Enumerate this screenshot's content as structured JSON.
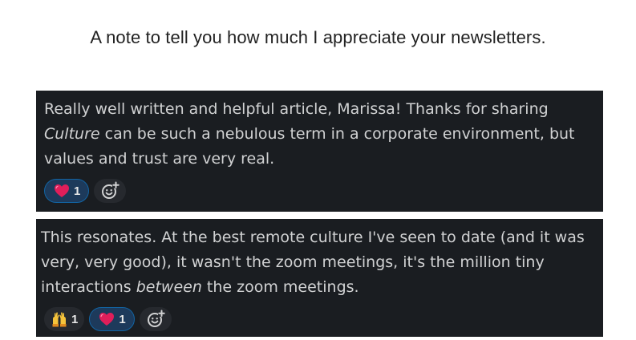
{
  "headline": "A note to tell you how much I appreciate your newsletters.",
  "messages": [
    {
      "line1": "Really well written and helpful article, Marissa! Thanks for sharing",
      "line2_italic": "Culture",
      "line2_rest": " can be such a nebulous term in a corporate environment, but",
      "line3": "values and trust are very real.",
      "reactions": [
        {
          "emoji": "heart-icon",
          "count": "1",
          "active": true
        }
      ]
    },
    {
      "line1": "This resonates. At the best remote culture I've seen to date (and it was",
      "line2": "very, very good), it wasn't the zoom meetings, it's the million tiny",
      "line3_pre": "interactions ",
      "line3_italic": "between",
      "line3_post": " the zoom meetings.",
      "reactions": [
        {
          "emoji": "raised-hands-icon",
          "count": "1",
          "active": false
        },
        {
          "emoji": "heart-icon",
          "count": "1",
          "active": true
        }
      ]
    }
  ],
  "colors": {
    "card_bg": "#1a1d21",
    "text": "#d1d2d3",
    "active_pill_bg": "#1d3a5b",
    "active_pill_border": "#1264a3",
    "pill_bg": "#26292e",
    "heart": "#e01e5a"
  }
}
